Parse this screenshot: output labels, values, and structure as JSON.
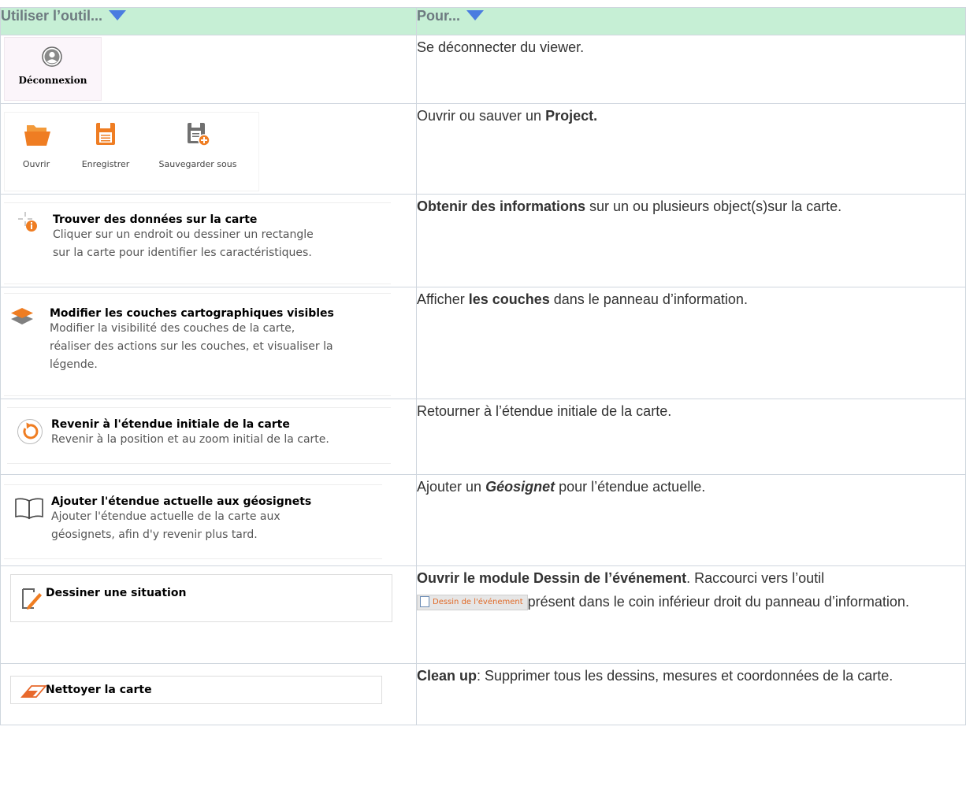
{
  "header": {
    "col_tool": "Utiliser l’outil...",
    "col_purpose": "Pour..."
  },
  "rows": [
    {
      "tool": {
        "icon": "user-icon",
        "label": "Déconnexion"
      },
      "purpose": {
        "text": "Se déconnecter du viewer."
      }
    },
    {
      "tool": {
        "items": [
          {
            "icon": "folder-open-icon",
            "label": "Ouvrir"
          },
          {
            "icon": "save-icon",
            "label": "Enregistrer"
          },
          {
            "icon": "save-as-icon",
            "label": "Sauvegarder sous"
          }
        ]
      },
      "purpose": {
        "pre": "Ouvrir ou sauver un ",
        "bold": "Project."
      }
    },
    {
      "tool": {
        "icon": "identify-icon",
        "title": "Trouver des données sur la carte",
        "desc_lines": [
          "Cliquer sur un endroit ou dessiner un rectangle",
          "sur la carte pour identifier les caractéristiques."
        ]
      },
      "purpose": {
        "bold": "Obtenir des informations",
        "post": " sur un ou plusieurs object(s)sur la carte."
      }
    },
    {
      "tool": {
        "icon": "layers-icon",
        "title": "Modifier les couches cartographiques visibles",
        "desc_lines": [
          "Modifier la visibilité des couches de la carte,",
          "réaliser des actions sur les couches, et visualiser la",
          "légende."
        ]
      },
      "purpose": {
        "pre": "Afficher ",
        "bold": "les couches",
        "post": " dans le panneau d’information."
      }
    },
    {
      "tool": {
        "icon": "reset-extent-icon",
        "title": "Revenir à l'étendue initiale de la carte",
        "desc_lines": [
          "Revenir à la position et au zoom initial de la carte."
        ]
      },
      "purpose": {
        "text": "Retourner à l’étendue initiale de la carte."
      }
    },
    {
      "tool": {
        "icon": "bookmark-book-icon",
        "title": "Ajouter l'étendue actuelle aux géosignets",
        "desc_lines": [
          "Ajouter l'étendue actuelle de la carte aux",
          "géosignets, afin d'y revenir plus tard."
        ]
      },
      "purpose": {
        "pre": "Ajouter un ",
        "bold_italic": "Géosignet",
        "post": " pour l’étendue actuelle."
      }
    },
    {
      "tool": {
        "icon": "draw-pencil-icon",
        "title": "Dessiner une situation"
      },
      "purpose": {
        "bold": "Ouvrir le module Dessin de l’événement",
        "mid": ".  Raccourci vers l’outil",
        "inline_tool_label": "Dessin de l'événement",
        "post": "présent dans le coin inférieur droit du panneau d’information."
      }
    },
    {
      "tool": {
        "icon": "eraser-icon",
        "title": "Nettoyer la carte"
      },
      "purpose": {
        "bold": "Clean up",
        "post": ": Supprimer tous les dessins, mesures et coordonnées de la carte."
      }
    }
  ],
  "colors": {
    "header_bg": "#c6efd5",
    "triangle": "#4a7ce0",
    "orange": "#ef7d22",
    "eraser": "#e8692c"
  }
}
